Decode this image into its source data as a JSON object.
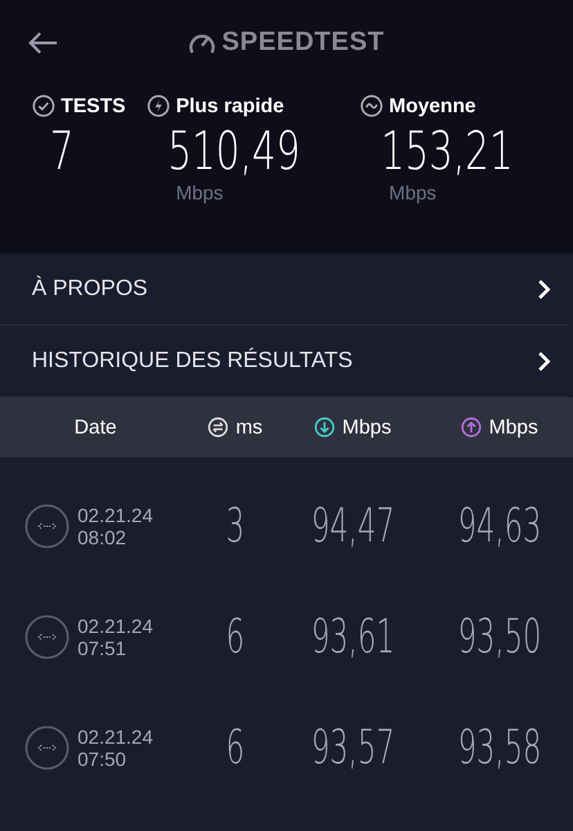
{
  "header": {
    "logo": "SPEEDTEST"
  },
  "stats": [
    {
      "kind": "tests",
      "label": "TESTS",
      "value": "7"
    },
    {
      "kind": "fastest",
      "label": "Plus rapide",
      "value": "510,49",
      "unit": "Mbps"
    },
    {
      "kind": "average",
      "label": "Moyenne",
      "value": "153,21",
      "unit": "Mbps"
    }
  ],
  "menu": [
    {
      "label": "À PROPOS"
    },
    {
      "label": "HISTORIQUE DES RÉSULTATS"
    }
  ],
  "table": {
    "columns": [
      {
        "kind": "date",
        "label": "Date"
      },
      {
        "kind": "ping",
        "label": "ms"
      },
      {
        "kind": "download",
        "label": "Mbps"
      },
      {
        "kind": "upload",
        "label": "Mbps"
      }
    ],
    "rows": [
      {
        "date": "02.21.24",
        "time": "08:02",
        "ping": "3",
        "download": "94,47",
        "upload": "94,63"
      },
      {
        "date": "02.21.24",
        "time": "07:51",
        "ping": "6",
        "download": "93,61",
        "upload": "93,50"
      },
      {
        "date": "02.21.24",
        "time": "07:50",
        "ping": "6",
        "download": "93,57",
        "upload": "93,58"
      }
    ]
  }
}
